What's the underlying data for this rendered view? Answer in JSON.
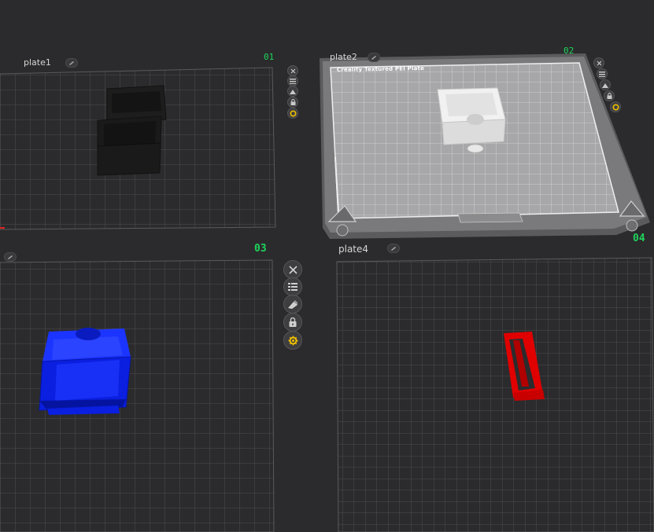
{
  "plates": [
    {
      "name": "plate1",
      "index": "01",
      "object_color": "#1c1c1c"
    },
    {
      "name": "plate2",
      "index": "02",
      "bed_title": "Creality Textured PEI Plate",
      "bed_brand": "CREALITY",
      "object_color": "#e6e6e6"
    },
    {
      "name": "",
      "index": "03",
      "object_color": "#0a1fe0"
    },
    {
      "name": "plate4",
      "index": "04",
      "object_color": "#e00000"
    }
  ],
  "plate_tool_icons": [
    "close-icon",
    "arrange-icon",
    "orient-icon",
    "lock-icon",
    "settings-gear-icon"
  ],
  "colors": {
    "background": "#2b2b2d",
    "grid_line": "#4a4a4c",
    "plate_index": "#1fd35b",
    "selected_gear": "#f0c000"
  }
}
